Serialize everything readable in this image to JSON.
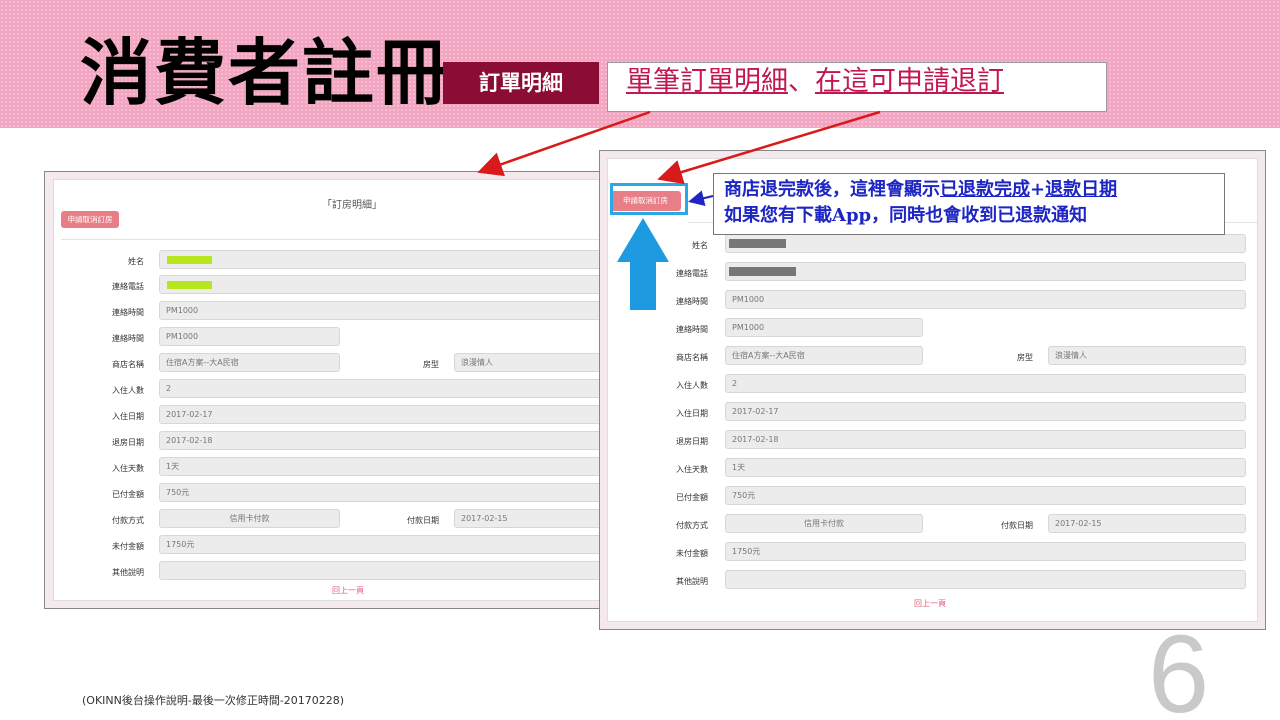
{
  "slide": {
    "title": "消費者註冊",
    "tag": "訂單明細",
    "headline_part1": "單筆訂單明細",
    "headline_sep": "、",
    "headline_part2": "在這可申請退訂",
    "page_number": "6",
    "footer": "(OKINN後台操作說明-最後一次修正時間-20170228)"
  },
  "form": {
    "title": "「訂房明細」",
    "cancel_button": "申請取消訂房",
    "labels": {
      "name": "姓名",
      "phone": "連絡電話",
      "contact_time_1": "連絡時間",
      "contact_time_2": "連絡時間",
      "store": "商店名稱",
      "room_type": "房型",
      "guests": "入住人數",
      "checkin": "入住日期",
      "checkout": "退房日期",
      "nights": "入住天數",
      "paid": "已付金額",
      "pay_method": "付款方式",
      "pay_date": "付款日期",
      "unpaid": "未付金額",
      "notes": "其他說明"
    },
    "values": {
      "contact_time_1": "PM1000",
      "contact_time_2": "PM1000",
      "store": "住宿A方案--大A民宿",
      "room_type": "浪漫情人",
      "guests": "2",
      "checkin": "2017-02-17",
      "checkout": "2017-02-18",
      "nights": "1天",
      "paid": "750元",
      "pay_method": "信用卡付款",
      "pay_date": "2017-02-15",
      "unpaid": "1750元",
      "notes": ""
    },
    "back_link": "回上一頁"
  },
  "callout": {
    "line1_prefix": "商店退完款後，這裡會顯示",
    "line1_refund_done": "已退款完成",
    "line1_plus": "+",
    "line1_refund_date": "退款日期",
    "line2": "如果您有下載App，同時也會收到已退款通知"
  },
  "colors": {
    "header_band": "#f3a6c1",
    "tag_bg": "#8c0d33",
    "headline_text": "#c2184f",
    "cancel_button": "#e97f86",
    "callout_text": "#1d25c4",
    "arrow_red": "#d91a1a",
    "arrow_blue": "#1d9ae0"
  }
}
